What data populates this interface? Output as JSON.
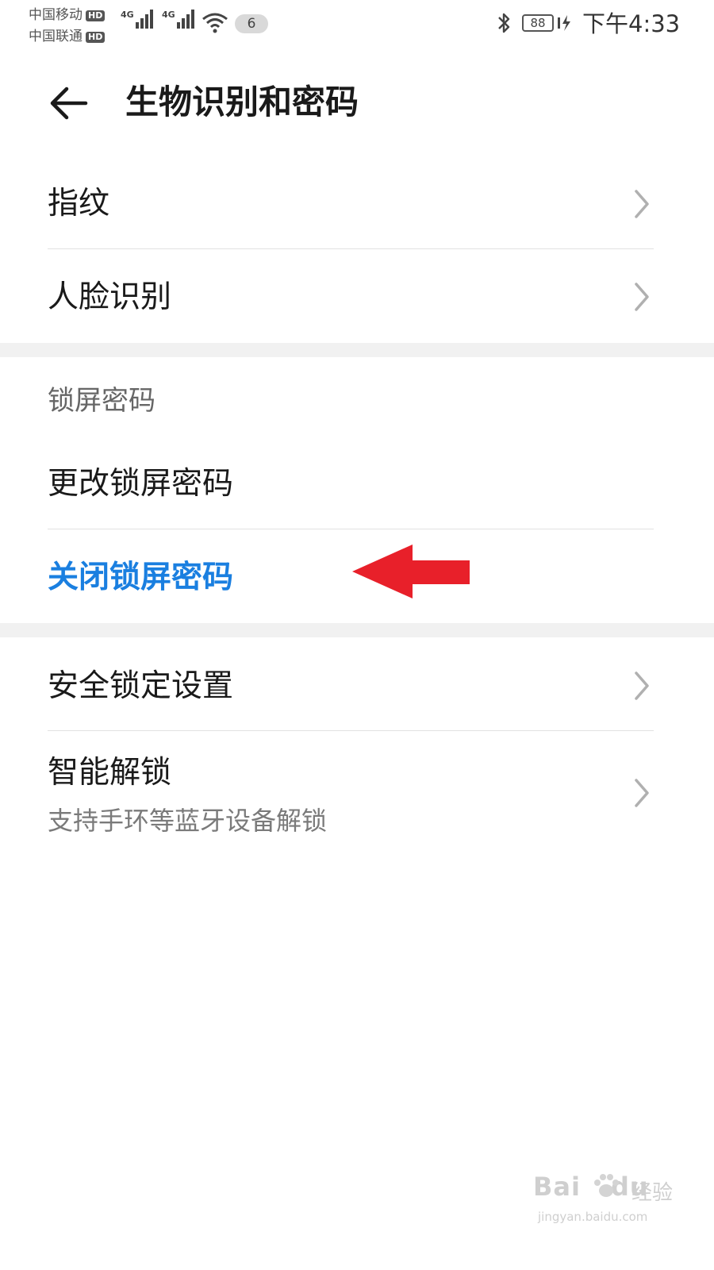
{
  "status_bar": {
    "carrier_1": "中国移动",
    "carrier_2": "中国联通",
    "hd_badge": "HD",
    "network_1": "4G",
    "network_2": "4G",
    "notification_count": "6",
    "battery_level": "88",
    "time": "下午4:33",
    "icons": [
      "signal-icon",
      "wifi-icon",
      "bluetooth-icon",
      "battery-icon",
      "charging-icon"
    ]
  },
  "header": {
    "back_icon": "arrow-left-icon",
    "title": "生物识别和密码"
  },
  "biometrics": {
    "items": [
      {
        "label": "指纹",
        "icon": "chevron-right-icon"
      },
      {
        "label": "人脸识别",
        "icon": "chevron-right-icon"
      }
    ]
  },
  "lock_screen": {
    "section_title": "锁屏密码",
    "change_label": "更改锁屏密码",
    "disable_label": "关闭锁屏密码",
    "accent_color": "#1a7fe0"
  },
  "other": {
    "items": [
      {
        "label": "安全锁定设置",
        "icon": "chevron-right-icon"
      },
      {
        "label": "智能解锁",
        "subtitle": "支持手环等蓝牙设备解锁",
        "icon": "chevron-right-icon"
      }
    ]
  },
  "annotation": {
    "arrow_color": "#e8202a",
    "icon": "red-arrow-icon"
  },
  "watermark": {
    "brand": "Bai",
    "brand_suffix": "du",
    "tag": "经验",
    "url": "jingyan.baidu.com"
  }
}
